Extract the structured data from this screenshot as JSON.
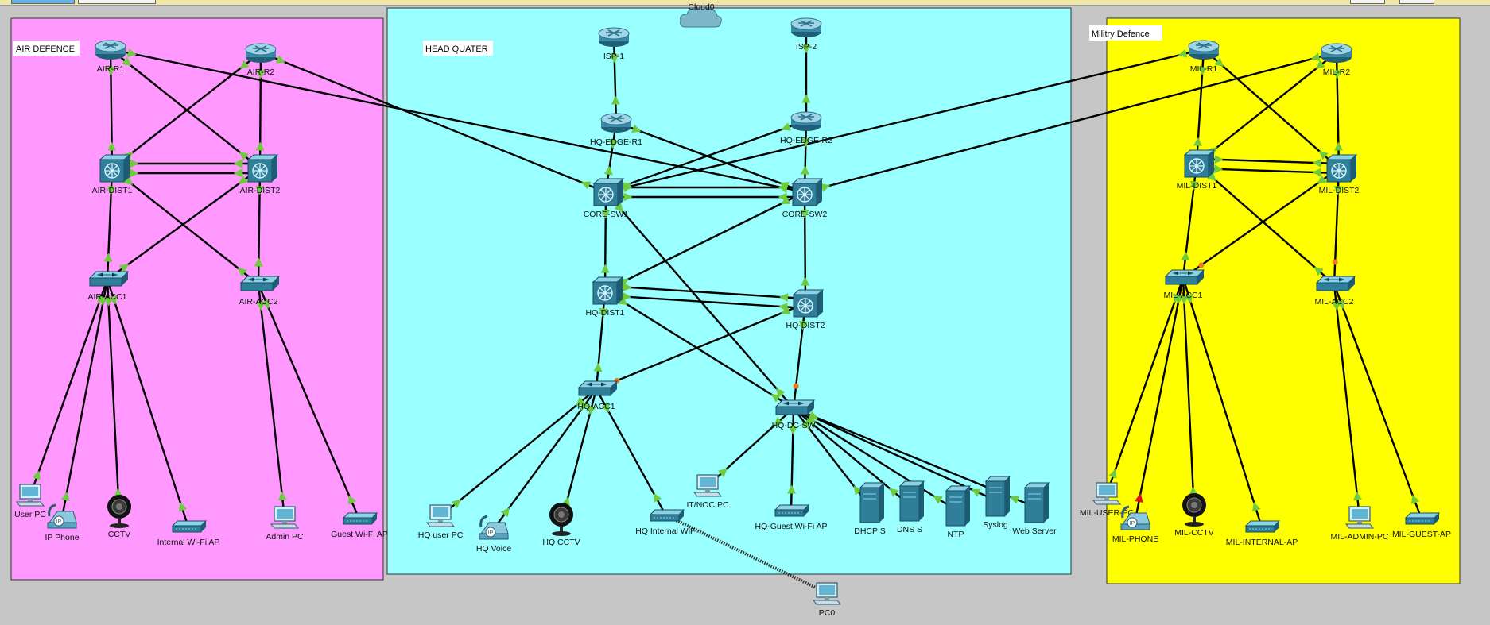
{
  "toolbar": {
    "buttons": [
      "",
      ""
    ],
    "right_buttons": [
      "",
      ""
    ]
  },
  "areas": [
    {
      "id": "air",
      "label": "AIR DEFENCE",
      "color": "#ff99ff"
    },
    {
      "id": "hq",
      "label": "HEAD QUATER",
      "color": "#99ffff"
    },
    {
      "id": "mil",
      "label": "Militry Defence",
      "color": "#ffff00"
    }
  ],
  "devices": [
    {
      "id": "cloud0",
      "label": "Cloud0",
      "type": "cloud"
    },
    {
      "id": "isp1",
      "label": "ISP-1",
      "type": "router"
    },
    {
      "id": "isp2",
      "label": "ISP-2",
      "type": "router"
    },
    {
      "id": "hqedge1",
      "label": "HQ-EDGE-R1",
      "type": "router"
    },
    {
      "id": "hqedge2",
      "label": "HQ-EDGE-R2",
      "type": "router"
    },
    {
      "id": "coresw1",
      "label": "CORE-SW1",
      "type": "multilayer"
    },
    {
      "id": "coresw2",
      "label": "CORE-SW2",
      "type": "multilayer"
    },
    {
      "id": "hqdist1",
      "label": "HQ-DIST1",
      "type": "multilayer"
    },
    {
      "id": "hqdist2",
      "label": "HQ-DIST2",
      "type": "multilayer"
    },
    {
      "id": "hqacc1",
      "label": "HQ-ACC1",
      "type": "switch"
    },
    {
      "id": "hqdcsw",
      "label": "HQ-DC-SW",
      "type": "switch"
    },
    {
      "id": "hquserpc",
      "label": "HQ user PC",
      "type": "pc"
    },
    {
      "id": "hqvoice",
      "label": "HQ Voice",
      "type": "phone"
    },
    {
      "id": "hqcctv",
      "label": "HQ CCTV",
      "type": "camera"
    },
    {
      "id": "hqintwifi",
      "label": "HQ Internal WiFi",
      "type": "ap"
    },
    {
      "id": "itnocpc",
      "label": "IT/NOC PC",
      "type": "pc"
    },
    {
      "id": "hqguestwifi",
      "label": "HQ-Guest Wi-Fi AP",
      "type": "ap"
    },
    {
      "id": "dhcps",
      "label": "DHCP S",
      "type": "server"
    },
    {
      "id": "dnss",
      "label": "DNS S",
      "type": "server"
    },
    {
      "id": "ntp",
      "label": "NTP",
      "type": "server"
    },
    {
      "id": "syslog",
      "label": "Syslog",
      "type": "server"
    },
    {
      "id": "webserver",
      "label": "Web Server",
      "type": "server"
    },
    {
      "id": "pc0",
      "label": "PC0",
      "type": "pc"
    },
    {
      "id": "airr1",
      "label": "AIR-R1",
      "type": "router"
    },
    {
      "id": "airr2",
      "label": "AIR-R2",
      "type": "router"
    },
    {
      "id": "airdist1",
      "label": "AIR-DIST1",
      "type": "multilayer"
    },
    {
      "id": "airdist2",
      "label": "AIR-DIST2",
      "type": "multilayer"
    },
    {
      "id": "airacc1",
      "label": "AIR-ACC1",
      "type": "switch"
    },
    {
      "id": "airacc2",
      "label": "AIR-ACC2",
      "type": "switch"
    },
    {
      "id": "airuserpc",
      "label": "User PC",
      "type": "pc"
    },
    {
      "id": "airipphone",
      "label": "IP Phone",
      "type": "phone"
    },
    {
      "id": "aircctv",
      "label": "CCTV",
      "type": "camera"
    },
    {
      "id": "airintwifi",
      "label": "Internal Wi-Fi AP",
      "type": "ap"
    },
    {
      "id": "airadminpc",
      "label": "Admin PC",
      "type": "pc"
    },
    {
      "id": "airguestwifi",
      "label": "Guest Wi-Fi AP",
      "type": "ap"
    },
    {
      "id": "milr1",
      "label": "MIL-R1",
      "type": "router"
    },
    {
      "id": "milr2",
      "label": "MIL-R2",
      "type": "router"
    },
    {
      "id": "mildist1",
      "label": "MIL-DIST1",
      "type": "multilayer"
    },
    {
      "id": "mildist2",
      "label": "MIL-DIST2",
      "type": "multilayer"
    },
    {
      "id": "milacc1",
      "label": "MIL-ACC1",
      "type": "switch"
    },
    {
      "id": "milacc2",
      "label": "MIL-ACC2",
      "type": "switch"
    },
    {
      "id": "miluserpc",
      "label": "MIL-USER-PC",
      "type": "pc"
    },
    {
      "id": "milphone",
      "label": "MIL-PHONE",
      "type": "phone"
    },
    {
      "id": "milcctv",
      "label": "MIL-CCTV",
      "type": "camera"
    },
    {
      "id": "milintap",
      "label": "MIL-INTERNAL-AP",
      "type": "ap"
    },
    {
      "id": "miladminpc",
      "label": "MIL-ADMIN-PC",
      "type": "pc"
    },
    {
      "id": "milguestap",
      "label": "MIL-GUEST-AP",
      "type": "ap"
    }
  ],
  "links": [
    [
      "isp1",
      "hqedge1",
      "up"
    ],
    [
      "isp2",
      "hqedge2",
      "up"
    ],
    [
      "hqedge1",
      "coresw1",
      "up"
    ],
    [
      "hqedge1",
      "coresw2",
      "up"
    ],
    [
      "hqedge2",
      "coresw1",
      "up"
    ],
    [
      "hqedge2",
      "coresw2",
      "up"
    ],
    [
      "coresw1",
      "coresw2",
      "up"
    ],
    [
      "coresw1",
      "coresw2",
      "up"
    ],
    [
      "coresw1",
      "hqdist1",
      "up"
    ],
    [
      "coresw1",
      "hqdcsw",
      "up"
    ],
    [
      "coresw2",
      "hqdist2",
      "up"
    ],
    [
      "coresw2",
      "hqdist1",
      "up"
    ],
    [
      "hqdist1",
      "hqdist2",
      "up"
    ],
    [
      "hqdist1",
      "hqdist2",
      "up"
    ],
    [
      "hqdist1",
      "hqacc1",
      "up"
    ],
    [
      "hqdist1",
      "hqdcsw",
      "up"
    ],
    [
      "hqdist2",
      "hqacc1",
      "blocking"
    ],
    [
      "hqdist2",
      "hqdcsw",
      "blocking"
    ],
    [
      "hqacc1",
      "hquserpc",
      "up"
    ],
    [
      "hqacc1",
      "hqvoice",
      "up"
    ],
    [
      "hqacc1",
      "hqcctv",
      "up"
    ],
    [
      "hqacc1",
      "hqintwifi",
      "up"
    ],
    [
      "hqdcsw",
      "itnocpc",
      "up"
    ],
    [
      "hqdcsw",
      "hqguestwifi",
      "up"
    ],
    [
      "hqdcsw",
      "dhcps",
      "up"
    ],
    [
      "hqdcsw",
      "dnss",
      "up"
    ],
    [
      "hqdcsw",
      "ntp",
      "up"
    ],
    [
      "hqdcsw",
      "syslog",
      "up"
    ],
    [
      "hqdcsw",
      "webserver",
      "up"
    ],
    [
      "airr1",
      "coresw2",
      "up"
    ],
    [
      "airr2",
      "coresw1",
      "up"
    ],
    [
      "milr1",
      "coresw1",
      "up"
    ],
    [
      "milr2",
      "coresw2",
      "up"
    ],
    [
      "airr1",
      "airdist1",
      "up"
    ],
    [
      "airr1",
      "airdist2",
      "up"
    ],
    [
      "airr2",
      "airdist1",
      "up"
    ],
    [
      "airr2",
      "airdist2",
      "up"
    ],
    [
      "airdist1",
      "airdist2",
      "up"
    ],
    [
      "airdist1",
      "airdist2",
      "up"
    ],
    [
      "airdist1",
      "airacc1",
      "up"
    ],
    [
      "airdist1",
      "airacc2",
      "up"
    ],
    [
      "airdist2",
      "airacc1",
      "up"
    ],
    [
      "airdist2",
      "airacc2",
      "up"
    ],
    [
      "airacc1",
      "airuserpc",
      "up"
    ],
    [
      "airacc1",
      "airipphone",
      "up"
    ],
    [
      "airacc1",
      "aircctv",
      "up"
    ],
    [
      "airacc1",
      "airintwifi",
      "up"
    ],
    [
      "airacc2",
      "airadminpc",
      "up"
    ],
    [
      "airacc2",
      "airguestwifi",
      "up"
    ],
    [
      "milr1",
      "mildist1",
      "up"
    ],
    [
      "milr1",
      "mildist2",
      "up"
    ],
    [
      "milr2",
      "mildist1",
      "up"
    ],
    [
      "milr2",
      "mildist2",
      "up"
    ],
    [
      "mildist1",
      "mildist2",
      "up"
    ],
    [
      "mildist1",
      "mildist2",
      "up"
    ],
    [
      "mildist1",
      "milacc1",
      "up"
    ],
    [
      "mildist1",
      "milacc2",
      "up"
    ],
    [
      "mildist2",
      "milacc1",
      "blocking"
    ],
    [
      "mildist2",
      "milacc2",
      "blocking"
    ],
    [
      "milacc1",
      "miluserpc",
      "up"
    ],
    [
      "milacc1",
      "milphone",
      "down"
    ],
    [
      "milacc1",
      "milcctv",
      "up"
    ],
    [
      "milacc1",
      "milintap",
      "up"
    ],
    [
      "milacc2",
      "miladminpc",
      "up"
    ],
    [
      "milacc2",
      "milguestap",
      "up"
    ]
  ],
  "wireless_links": [
    [
      "hqintwifi",
      "pc0"
    ]
  ],
  "colors": {
    "link": "#000000",
    "link_up": "#6ecb3c",
    "link_blocking": "#f07b1c",
    "link_down": "#e01010",
    "device_main": "#2f7e9a",
    "device_light": "#8cd2e6"
  }
}
